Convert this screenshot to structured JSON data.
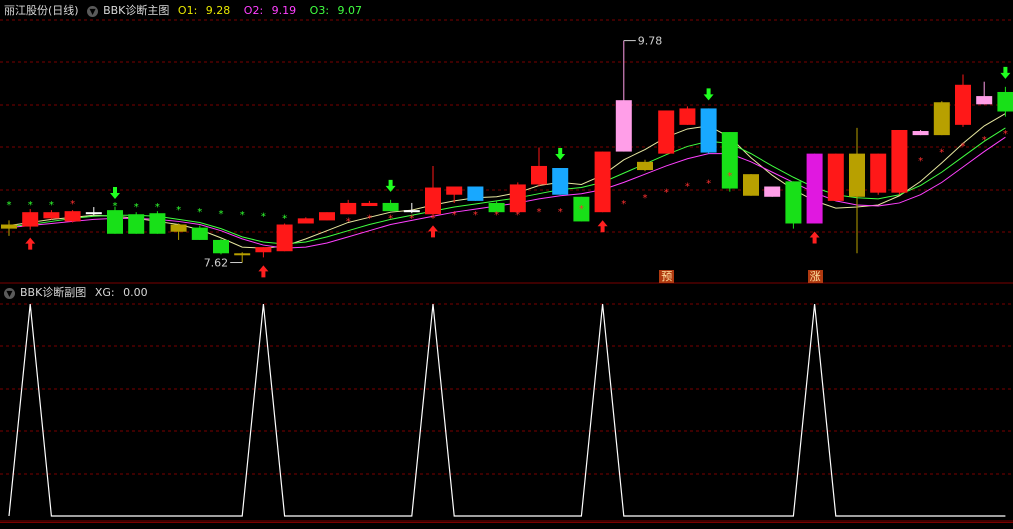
{
  "main_header": {
    "stock": "丽江股份(日线)",
    "indicator": "BBK诊断主图",
    "o1_label": "O1:",
    "o1_value": "9.28",
    "o2_label": "O2:",
    "o2_value": "9.19",
    "o3_label": "O3:",
    "o3_value": "9.07"
  },
  "sub_header": {
    "indicator": "BBK诊断副图",
    "xg_label": "XG:",
    "xg_value": "0.00"
  },
  "annotations": {
    "high_price": "9.78",
    "low_price": "7.62",
    "badge_predict": "预",
    "badge_rise": "涨"
  },
  "colors": {
    "background": "#000000",
    "grid": "#7a0000",
    "up": "#ff2020",
    "down": "#20e020",
    "ma_yellow": "#e8e8a0",
    "ma_green": "#40ff40",
    "ma_magenta": "#ff40ff",
    "sub_line": "#ffffff"
  },
  "chart_data": [
    {
      "type": "candlestick",
      "title": "BBK诊断主图",
      "ylim": [
        7.45,
        10.0
      ],
      "colors_legend": {
        "red": "up",
        "green": "down",
        "cyan": "blue signal",
        "pink": "pink signal",
        "gold": "gold signal",
        "magenta": "magenta signal"
      },
      "candles": [
        {
          "o": 7.95,
          "c": 7.99,
          "h": 8.03,
          "l": 7.88,
          "col": "gold"
        },
        {
          "o": 7.97,
          "c": 8.11,
          "h": 8.14,
          "l": 7.94,
          "col": "red"
        },
        {
          "o": 8.05,
          "c": 8.11,
          "h": 8.13,
          "l": 8.04,
          "col": "red"
        },
        {
          "o": 8.02,
          "c": 8.12,
          "h": 8.13,
          "l": 8.01,
          "col": "red"
        },
        {
          "o": 8.11,
          "c": 8.1,
          "h": 8.16,
          "l": 8.08,
          "col": "white"
        },
        {
          "o": 8.13,
          "c": 7.9,
          "h": 8.16,
          "l": 7.9,
          "col": "green"
        },
        {
          "o": 8.09,
          "c": 7.9,
          "h": 8.11,
          "l": 7.9,
          "col": "green"
        },
        {
          "o": 8.1,
          "c": 7.9,
          "h": 8.12,
          "l": 7.9,
          "col": "green"
        },
        {
          "o": 7.99,
          "c": 7.92,
          "h": 8.0,
          "l": 7.84,
          "col": "gold"
        },
        {
          "o": 7.96,
          "c": 7.84,
          "h": 7.98,
          "l": 7.84,
          "col": "green"
        },
        {
          "o": 7.84,
          "c": 7.71,
          "h": 7.85,
          "l": 7.7,
          "col": "green"
        },
        {
          "o": 7.7,
          "c": 7.71,
          "h": 7.72,
          "l": 7.62,
          "col": "gold"
        },
        {
          "o": 7.72,
          "c": 7.77,
          "h": 7.77,
          "l": 7.67,
          "col": "red"
        },
        {
          "o": 7.73,
          "c": 7.99,
          "h": 8.0,
          "l": 7.73,
          "col": "red"
        },
        {
          "o": 8.0,
          "c": 8.05,
          "h": 8.06,
          "l": 8.0,
          "col": "red"
        },
        {
          "o": 8.03,
          "c": 8.11,
          "h": 8.11,
          "l": 8.03,
          "col": "red"
        },
        {
          "o": 8.09,
          "c": 8.2,
          "h": 8.23,
          "l": 8.09,
          "col": "red"
        },
        {
          "o": 8.17,
          "c": 8.2,
          "h": 8.22,
          "l": 8.17,
          "col": "red"
        },
        {
          "o": 8.2,
          "c": 8.12,
          "h": 8.23,
          "l": 8.12,
          "col": "green"
        },
        {
          "o": 8.13,
          "c": 8.11,
          "h": 8.2,
          "l": 8.1,
          "col": "white"
        },
        {
          "o": 8.09,
          "c": 8.35,
          "h": 8.56,
          "l": 8.06,
          "col": "red"
        },
        {
          "o": 8.36,
          "c": 8.28,
          "h": 8.36,
          "l": 8.2,
          "col": "red"
        },
        {
          "o": 8.36,
          "c": 8.22,
          "h": 8.36,
          "l": 8.22,
          "col": "cyan"
        },
        {
          "o": 8.2,
          "c": 8.11,
          "h": 8.22,
          "l": 8.11,
          "col": "green"
        },
        {
          "o": 8.11,
          "c": 8.38,
          "h": 8.4,
          "l": 8.11,
          "col": "red"
        },
        {
          "o": 8.38,
          "c": 8.56,
          "h": 8.74,
          "l": 8.36,
          "col": "red"
        },
        {
          "o": 8.54,
          "c": 8.28,
          "h": 8.54,
          "l": 8.28,
          "col": "cyan"
        },
        {
          "o": 8.26,
          "c": 8.02,
          "h": 8.26,
          "l": 8.02,
          "col": "green"
        },
        {
          "o": 8.11,
          "c": 8.7,
          "h": 8.7,
          "l": 8.11,
          "col": "red"
        },
        {
          "o": 8.7,
          "c": 9.2,
          "h": 9.78,
          "l": 8.7,
          "col": "pink"
        },
        {
          "o": 8.6,
          "c": 8.52,
          "h": 8.62,
          "l": 8.51,
          "col": "gold"
        },
        {
          "o": 8.68,
          "c": 9.1,
          "h": 9.1,
          "l": 8.68,
          "col": "red"
        },
        {
          "o": 8.96,
          "c": 9.12,
          "h": 9.14,
          "l": 8.96,
          "col": "red"
        },
        {
          "o": 9.12,
          "c": 8.69,
          "h": 9.12,
          "l": 8.68,
          "col": "cyan"
        },
        {
          "o": 8.89,
          "c": 8.34,
          "h": 8.89,
          "l": 8.31,
          "col": "green"
        },
        {
          "o": 8.48,
          "c": 8.27,
          "h": 8.48,
          "l": 8.27,
          "col": "gold"
        },
        {
          "o": 8.36,
          "c": 8.26,
          "h": 8.36,
          "l": 8.26,
          "col": "pink"
        },
        {
          "o": 8.41,
          "c": 8.0,
          "h": 8.41,
          "l": 7.95,
          "col": "green"
        },
        {
          "o": 8.68,
          "c": 8.0,
          "h": 8.68,
          "l": 8.0,
          "col": "magenta"
        },
        {
          "o": 8.22,
          "c": 8.68,
          "h": 8.68,
          "l": 8.22,
          "col": "red"
        },
        {
          "o": 8.26,
          "c": 8.68,
          "h": 8.93,
          "l": 7.71,
          "col": "gold"
        },
        {
          "o": 8.3,
          "c": 8.68,
          "h": 8.68,
          "l": 8.28,
          "col": "red"
        },
        {
          "o": 8.3,
          "c": 8.91,
          "h": 8.91,
          "l": 8.28,
          "col": "red"
        },
        {
          "o": 8.86,
          "c": 8.9,
          "h": 8.91,
          "l": 8.86,
          "col": "pink"
        },
        {
          "o": 8.86,
          "c": 9.18,
          "h": 9.19,
          "l": 8.86,
          "col": "gold"
        },
        {
          "o": 8.96,
          "c": 9.35,
          "h": 9.45,
          "l": 8.94,
          "col": "red"
        },
        {
          "o": 9.24,
          "c": 9.16,
          "h": 9.38,
          "l": 9.16,
          "col": "pink"
        },
        {
          "o": 9.28,
          "c": 9.09,
          "h": 9.33,
          "l": 9.04,
          "col": "green"
        }
      ],
      "ma_lines": [
        {
          "name": "O1",
          "color": "#e8e8a0",
          "values": [
            7.98,
            8.01,
            8.04,
            8.06,
            8.08,
            8.07,
            8.05,
            8.02,
            7.99,
            7.94,
            7.86,
            7.77,
            7.76,
            7.78,
            7.85,
            7.93,
            8.01,
            8.06,
            8.11,
            8.13,
            8.18,
            8.22,
            8.25,
            8.26,
            8.3,
            8.37,
            8.4,
            8.38,
            8.47,
            8.62,
            8.72,
            8.84,
            8.92,
            8.95,
            8.84,
            8.64,
            8.47,
            8.33,
            8.22,
            8.15,
            8.16,
            8.18,
            8.27,
            8.41,
            8.59,
            8.78,
            8.95,
            9.07
          ]
        },
        {
          "name": "O2",
          "color": "#40ff40",
          "values": [
            7.97,
            7.99,
            8.02,
            8.05,
            8.07,
            8.08,
            8.08,
            8.07,
            8.04,
            8.01,
            7.95,
            7.87,
            7.82,
            7.8,
            7.82,
            7.87,
            7.93,
            7.99,
            8.04,
            8.08,
            8.12,
            8.16,
            8.19,
            8.22,
            8.25,
            8.29,
            8.33,
            8.35,
            8.4,
            8.49,
            8.58,
            8.67,
            8.75,
            8.8,
            8.78,
            8.68,
            8.56,
            8.45,
            8.35,
            8.28,
            8.25,
            8.24,
            8.28,
            8.37,
            8.5,
            8.65,
            8.8,
            8.93
          ]
        },
        {
          "name": "O3",
          "color": "#ff40ff",
          "values": [
            7.96,
            7.98,
            8.0,
            8.02,
            8.04,
            8.05,
            8.05,
            8.04,
            8.02,
            7.99,
            7.93,
            7.85,
            7.79,
            7.76,
            7.77,
            7.81,
            7.87,
            7.93,
            7.99,
            8.03,
            8.07,
            8.11,
            8.14,
            8.17,
            8.2,
            8.24,
            8.27,
            8.29,
            8.33,
            8.4,
            8.48,
            8.56,
            8.63,
            8.68,
            8.68,
            8.6,
            8.5,
            8.4,
            8.3,
            8.22,
            8.18,
            8.17,
            8.2,
            8.28,
            8.4,
            8.55,
            8.7,
            8.84
          ]
        }
      ],
      "stars": [
        {
          "i": 0,
          "v": 8.19,
          "col": "green"
        },
        {
          "i": 1,
          "v": 8.19,
          "col": "green"
        },
        {
          "i": 2,
          "v": 8.19,
          "col": "green"
        },
        {
          "i": 3,
          "v": 8.2,
          "col": "red"
        },
        {
          "i": 5,
          "v": 8.18,
          "col": "green"
        },
        {
          "i": 6,
          "v": 8.17,
          "col": "green"
        },
        {
          "i": 7,
          "v": 8.17,
          "col": "green"
        },
        {
          "i": 8,
          "v": 8.14,
          "col": "green"
        },
        {
          "i": 9,
          "v": 8.12,
          "col": "green"
        },
        {
          "i": 10,
          "v": 8.1,
          "col": "green"
        },
        {
          "i": 11,
          "v": 8.09,
          "col": "green"
        },
        {
          "i": 12,
          "v": 8.08,
          "col": "green"
        },
        {
          "i": 13,
          "v": 8.06,
          "col": "green"
        },
        {
          "i": 16,
          "v": 8.03,
          "col": "red"
        },
        {
          "i": 17,
          "v": 8.06,
          "col": "red"
        },
        {
          "i": 18,
          "v": 8.06,
          "col": "red"
        },
        {
          "i": 19,
          "v": 8.06,
          "col": "red"
        },
        {
          "i": 20,
          "v": 8.06,
          "col": "red"
        },
        {
          "i": 21,
          "v": 8.09,
          "col": "red"
        },
        {
          "i": 22,
          "v": 8.09,
          "col": "red"
        },
        {
          "i": 23,
          "v": 8.09,
          "col": "red"
        },
        {
          "i": 24,
          "v": 8.09,
          "col": "red"
        },
        {
          "i": 25,
          "v": 8.12,
          "col": "red"
        },
        {
          "i": 26,
          "v": 8.12,
          "col": "red"
        },
        {
          "i": 27,
          "v": 8.15,
          "col": "red"
        },
        {
          "i": 29,
          "v": 8.2,
          "col": "red"
        },
        {
          "i": 30,
          "v": 8.26,
          "col": "red"
        },
        {
          "i": 31,
          "v": 8.31,
          "col": "red"
        },
        {
          "i": 32,
          "v": 8.37,
          "col": "red"
        },
        {
          "i": 33,
          "v": 8.4,
          "col": "red"
        },
        {
          "i": 34,
          "v": 8.47,
          "col": "red"
        },
        {
          "i": 43,
          "v": 8.62,
          "col": "red"
        },
        {
          "i": 44,
          "v": 8.7,
          "col": "red"
        },
        {
          "i": 45,
          "v": 8.76,
          "col": "red"
        },
        {
          "i": 46,
          "v": 8.82,
          "col": "red"
        },
        {
          "i": 47,
          "v": 8.88,
          "col": "red"
        }
      ],
      "buy_arrows": [
        1,
        12,
        20,
        28,
        38
      ],
      "sell_arrows": [
        5,
        18,
        26,
        33,
        47
      ],
      "badge_positions": [
        {
          "i": 31,
          "key": "badge_predict"
        },
        {
          "i": 38,
          "key": "badge_rise"
        }
      ],
      "high_marker": {
        "i": 29,
        "v": 9.78
      },
      "low_marker": {
        "i": 11,
        "v": 7.62
      }
    },
    {
      "type": "line",
      "title": "BBK诊断副图",
      "series_name": "XG",
      "ylim": [
        0,
        1
      ],
      "values": [
        0,
        1,
        0,
        0,
        0,
        0,
        0,
        0,
        0,
        0,
        0,
        0,
        1,
        0,
        0,
        0,
        0,
        0,
        0,
        0,
        1,
        0,
        0,
        0,
        0,
        0,
        0,
        0,
        1,
        0,
        0,
        0,
        0,
        0,
        0,
        0,
        0,
        0,
        1,
        0,
        0,
        0,
        0,
        0,
        0,
        0,
        0,
        0
      ]
    }
  ]
}
